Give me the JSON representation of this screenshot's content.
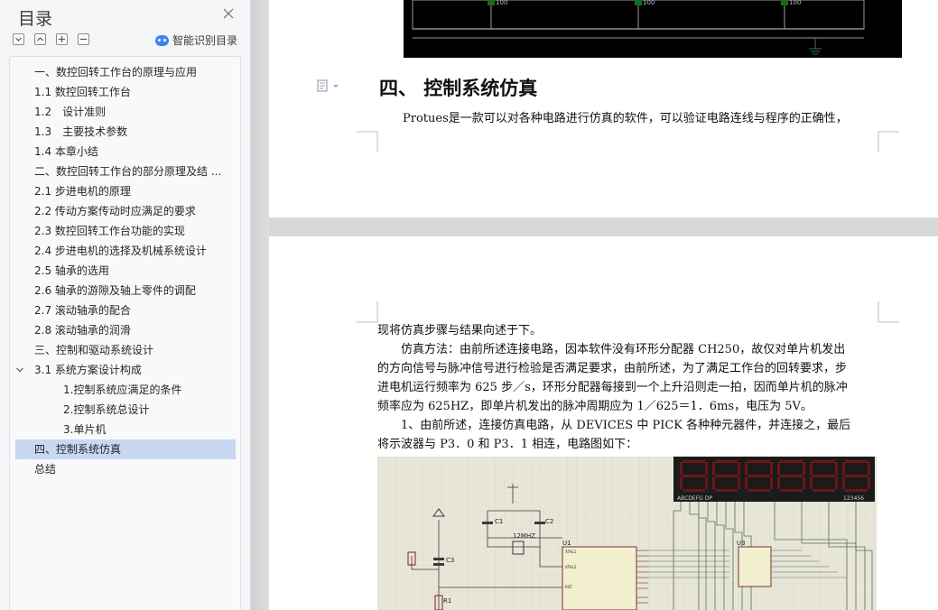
{
  "sidebar": {
    "title": "目录",
    "ai_button": "智能识别目录",
    "items": [
      {
        "label": "一、数控回转工作台的原理与应用",
        "level": 1
      },
      {
        "label": "1.1 数控回转工作台",
        "level": 1
      },
      {
        "label": "1.2　设计准则",
        "level": 1
      },
      {
        "label": "1.3　主要技术参数",
        "level": 1
      },
      {
        "label": "1.4 本章小结",
        "level": 1
      },
      {
        "label": "二、数控回转工作台的部分原理及结 ...",
        "level": 1
      },
      {
        "label": "2.1 步进电机的原理",
        "level": 1
      },
      {
        "label": "2.2 传动方案传动时应满足的要求",
        "level": 1
      },
      {
        "label": "2.3 数控回转工作台功能的实现",
        "level": 1
      },
      {
        "label": "2.4 步进电机的选择及机械系统设计",
        "level": 1
      },
      {
        "label": "2.5 轴承的选用",
        "level": 1
      },
      {
        "label": "2.6 轴承的游隙及轴上零件的调配",
        "level": 1
      },
      {
        "label": "2.7 滚动轴承的配合",
        "level": 1
      },
      {
        "label": "2.8 滚动轴承的润滑",
        "level": 1
      },
      {
        "label": "三、控制和驱动系统设计",
        "level": 1
      },
      {
        "label": "3.1 系统方案设计构成",
        "level": 1
      },
      {
        "label": "1.控制系统应满足的条件",
        "level": 2
      },
      {
        "label": "2.控制系统总设计",
        "level": 2
      },
      {
        "label": "3.单片机",
        "level": 2
      },
      {
        "label": "四、控制系统仿真",
        "level": 1
      },
      {
        "label": "总结",
        "level": 1
      }
    ]
  },
  "document": {
    "heading": "四、 控制系统仿真",
    "intro": "Protues是一款可以对各种电路进行仿真的软件，可以验证电路连线与程序的正确性，",
    "lines": [
      "现将仿真步骤与结果向述于下。",
      "　　仿真方法：由前所述连接电路，因本软件没有环形分配器 CH250，故仅对单片机发出",
      "的方向信号与脉冲信号进行检验是否满足要求，由前所述，为了满足工作台的回转要求，步",
      "进电机运行频率为 625 步／s，环形分配器每接到一个上升沿则走一拍，因而单片机的脉冲",
      "频率应为 625HZ，即单片机发出的脉冲周期应为 1／625＝1．6ms，电压为 5V。",
      "　　1、由前所述，连接仿真电路，从 DEVICES 中 PICK 各种种元器件，并连接之，最后",
      "将示波器与 P3．0 和 P3．1 相连，电路图如下："
    ],
    "circuit_top_labels": [
      "100",
      "100",
      "100"
    ],
    "circuit_labels": {
      "c1": "C1",
      "c2": "C2",
      "c3": "C3",
      "crystal": "12MHZ",
      "u1": "U1",
      "u3": "U3",
      "r1": "R1",
      "xtal1": "XTAL1",
      "xtal2": "XTAL2",
      "rst": "RST",
      "seg_label_left": "ABCDEFG DP",
      "seg_label_right": "123456"
    }
  },
  "colors": {
    "accent": "#3f86ec",
    "active_bg": "#c8d8f3",
    "segment": "#8a1b1b"
  }
}
